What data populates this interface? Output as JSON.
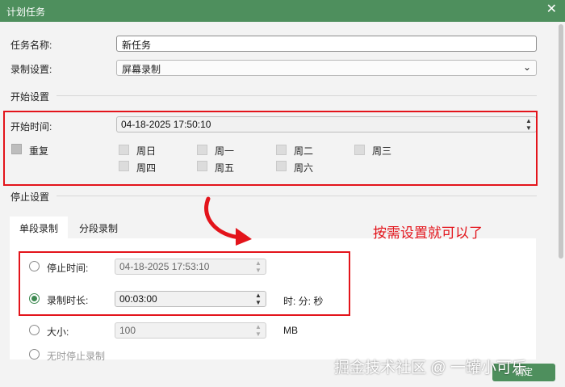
{
  "window": {
    "title": "计划任务",
    "close_glyph": "✕"
  },
  "task_name": {
    "label": "任务名称:",
    "value": "新任务"
  },
  "record_setting": {
    "label": "录制设置:",
    "value": "屏幕录制"
  },
  "start_section": {
    "heading": "开始设置",
    "start_time_label": "开始时间:",
    "start_time_value": "04-18-2025 17:50:10",
    "repeat_label": "重复",
    "days": [
      "周日",
      "周一",
      "周二",
      "周三",
      "周四",
      "周五",
      "周六"
    ]
  },
  "stop_section": {
    "heading": "停止设置",
    "tabs": [
      "单段录制",
      "分段录制"
    ],
    "stop_time_label": "停止时间:",
    "stop_time_value": "04-18-2025 17:53:10",
    "duration_label": "录制时长:",
    "duration_value": "00:03:00",
    "duration_unit": "时: 分: 秒",
    "size_label": "大小:",
    "size_value": "100",
    "size_unit": "MB",
    "cut_off_label": "无时停止录制"
  },
  "annotation": {
    "text": "按需设置就可以了",
    "color": "#e3141b"
  },
  "ok_button": "确定",
  "watermark": "掘金技术社区 @ 一罐小可乐",
  "colors": {
    "titlebar": "#4e8f5d",
    "accent": "#3e8a52",
    "highlight": "#e3141b"
  }
}
